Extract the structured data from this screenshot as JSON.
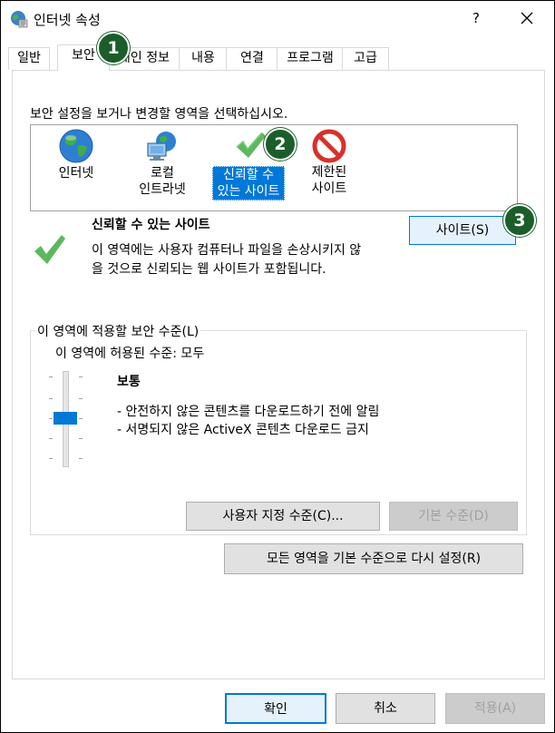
{
  "window": {
    "title": "인터넷 속성",
    "help_label": "?"
  },
  "tabs": [
    {
      "label": "일반"
    },
    {
      "label": "보안",
      "active": true
    },
    {
      "label": "개인 정보"
    },
    {
      "label": "내용"
    },
    {
      "label": "연결"
    },
    {
      "label": "프로그램"
    },
    {
      "label": "고급"
    }
  ],
  "security": {
    "zone_prompt": "보안 설정을 보거나 변경할 영역을 선택하십시오.",
    "zones": [
      {
        "line1": "인터넷",
        "line2": "",
        "icon": "globe-icon"
      },
      {
        "line1": "로컬",
        "line2": "인트라넷",
        "icon": "intranet-icon"
      },
      {
        "line1": "신뢰할 수",
        "line2": "있는 사이트",
        "icon": "checkmark-icon",
        "selected": true
      },
      {
        "line1": "제한된",
        "line2": "사이트",
        "icon": "restricted-icon"
      }
    ],
    "selected_zone_title": "신뢰할 수 있는 사이트",
    "selected_zone_desc_line1": "이 영역에는 사용자 컴퓨터나 파일을 손상시키지 않",
    "selected_zone_desc_line2": "을 것으로 신뢰되는 웹 사이트가 포함됩니다.",
    "sites_button": "사이트(S)",
    "level_group_label": "이 영역에 적용할 보안 수준(L)",
    "allowed_levels": "이 영역에 허용된 수준: 모두",
    "level_name": "보통",
    "level_desc_1": "- 안전하지 않은 콘텐츠를 다운로드하기 전에 알림",
    "level_desc_2": "- 서명되지 않은 ActiveX 콘텐츠 다운로드 금지",
    "slider_level": "보통",
    "custom_level_button": "사용자 지정 수준(C)...",
    "default_level_button": "기본 수준(D)",
    "reset_all_button": "모든 영역을 기본 수준으로 다시 설정(R)"
  },
  "footer": {
    "ok": "확인",
    "cancel": "취소",
    "apply": "적용(A)"
  },
  "annotations": [
    "1",
    "2",
    "3"
  ],
  "colors": {
    "accent": "#0078d7",
    "badge": "#1b5e2a",
    "check": "#5cb85c",
    "restricted": "#d9302c"
  }
}
